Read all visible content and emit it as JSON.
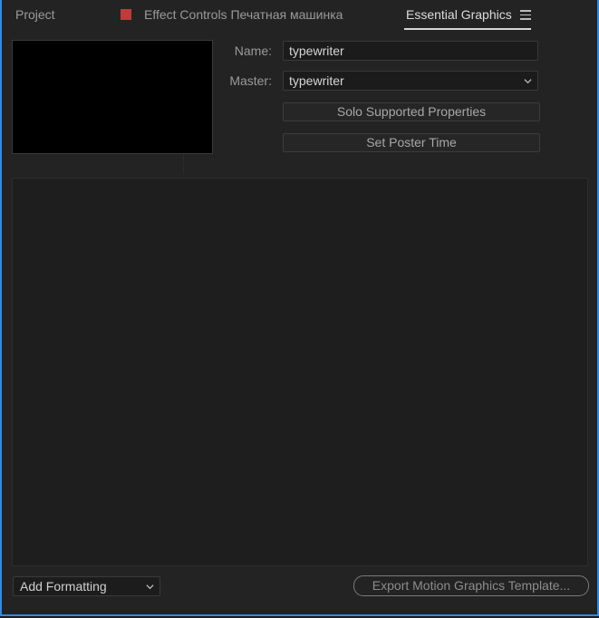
{
  "tabs": {
    "project": "Project",
    "effect_controls": "Effect Controls Печатная машинка",
    "essential_graphics": "Essential Graphics"
  },
  "colors": {
    "accent_border": "#2d8ceb",
    "effect_swatch": "#c23a3a"
  },
  "fields": {
    "name_label": "Name:",
    "name_value": "typewriter",
    "master_label": "Master:",
    "master_value": "typewriter"
  },
  "buttons": {
    "solo": "Solo Supported Properties",
    "poster": "Set Poster Time",
    "export": "Export Motion Graphics Template..."
  },
  "bottom": {
    "add_formatting": "Add Formatting"
  },
  "icons": {
    "menu": "hamburger-menu-icon",
    "dropdown": "chevron-down-icon"
  }
}
